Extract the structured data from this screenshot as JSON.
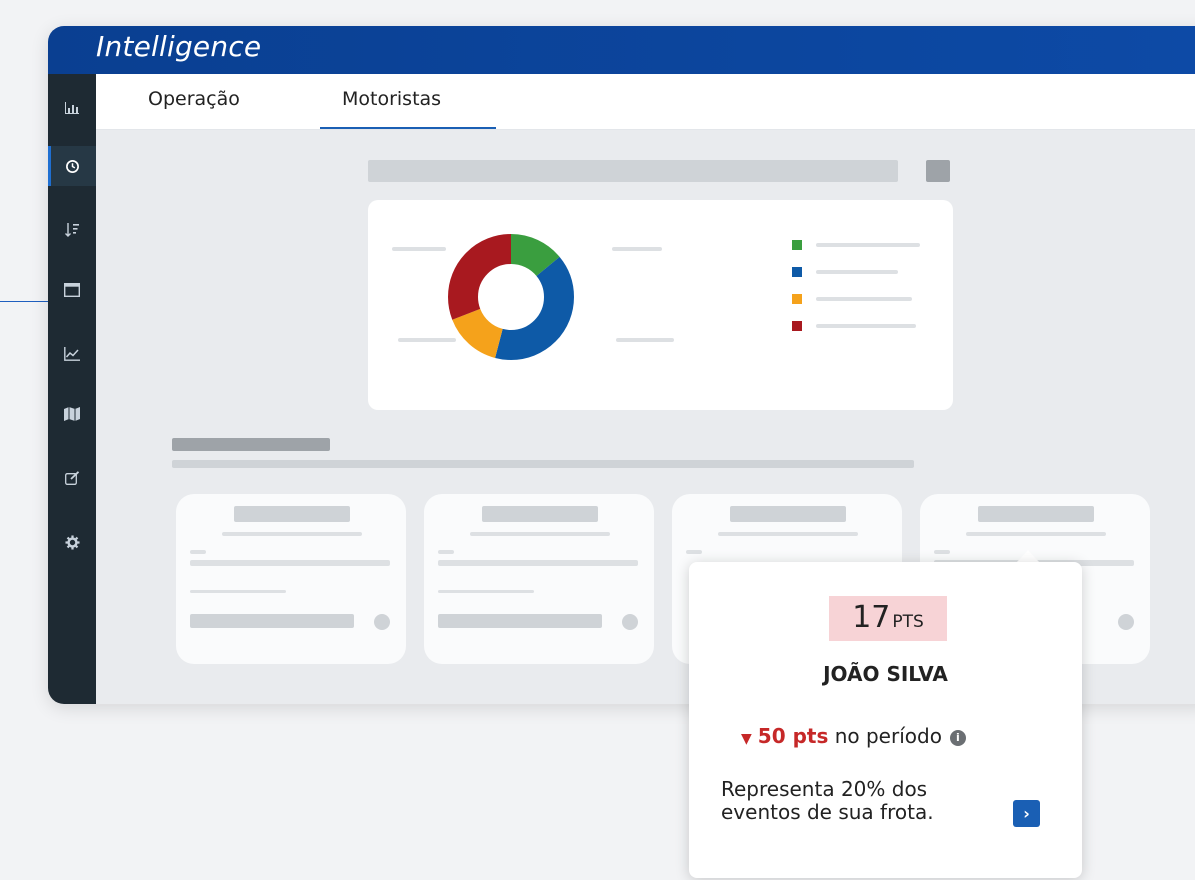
{
  "app": {
    "title": "Intelligence"
  },
  "sidebar": {
    "items": [
      {
        "icon": "bar-chart-icon",
        "glyph": "📊"
      },
      {
        "icon": "history-icon",
        "glyph": "↻",
        "active": true
      },
      {
        "icon": "sort-icon",
        "glyph": "⇅"
      },
      {
        "icon": "calendar-icon",
        "glyph": "▤"
      },
      {
        "icon": "line-chart-icon",
        "glyph": "⟋"
      },
      {
        "icon": "map-icon",
        "glyph": "▥"
      },
      {
        "icon": "edit-icon",
        "glyph": "✎"
      },
      {
        "icon": "gear-icon",
        "glyph": "⚙"
      }
    ]
  },
  "tabs": [
    {
      "label": "Operação"
    },
    {
      "label": "Motoristas",
      "active": true
    }
  ],
  "chart": {
    "colors": [
      "#3a9e3f",
      "#0e5aa7",
      "#f5a21b",
      "#a8191f"
    ],
    "segments": [
      0.14,
      0.4,
      0.15,
      0.31
    ]
  },
  "popup": {
    "score": "17",
    "score_unit": "PTS",
    "driver_name": "JOÃO SILVA",
    "delta_value": "50 pts",
    "delta_suffix": "no período",
    "delta_icon": "caret-down-icon",
    "info_icon": "info-icon",
    "description": "Representa 20% dos eventos de sua frota.",
    "action_icon": "chevron-right-icon"
  }
}
